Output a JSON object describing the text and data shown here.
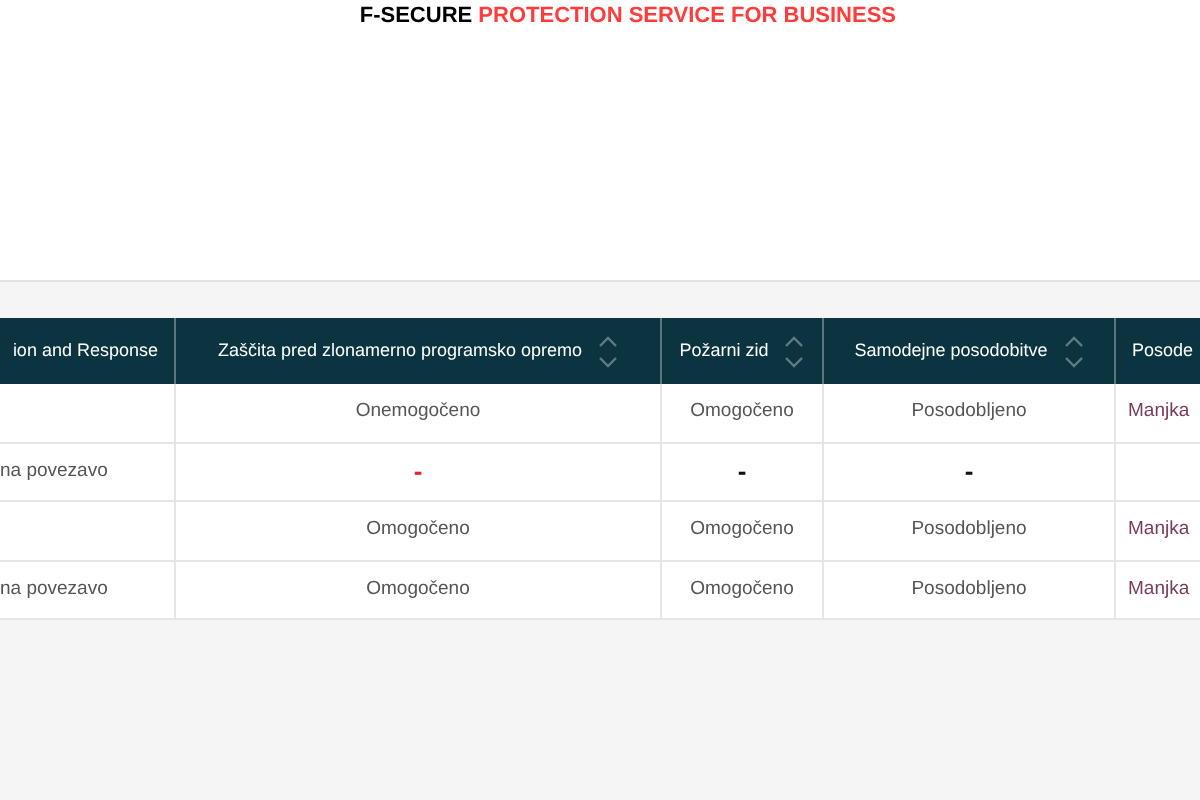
{
  "brand": {
    "name": "F-SECURE",
    "tagline": "PROTECTION SERVICE FOR BUSINESS"
  },
  "table": {
    "columns": [
      {
        "label": "ion and Response"
      },
      {
        "label": "Zaščita pred zlonamerno programsko opremo",
        "sortable": true
      },
      {
        "label": "Požarni zid",
        "sortable": true
      },
      {
        "label": "Samodejne posodobitve",
        "sortable": true
      },
      {
        "label": "Posode"
      }
    ],
    "rows": [
      [
        {
          "kind": "text",
          "text": ""
        },
        {
          "kind": "text",
          "text": "Onemogočeno"
        },
        {
          "kind": "text",
          "text": "Omogočeno"
        },
        {
          "kind": "text",
          "text": "Posodobljeno"
        },
        {
          "kind": "text",
          "text": "Manjka"
        }
      ],
      [
        {
          "kind": "text",
          "text": "na povezavo"
        },
        {
          "kind": "alert",
          "text": "-"
        },
        {
          "kind": "plain",
          "text": "-"
        },
        {
          "kind": "plain",
          "text": "-"
        },
        {
          "kind": "text",
          "text": ""
        }
      ],
      [
        {
          "kind": "text",
          "text": ""
        },
        {
          "kind": "text",
          "text": "Omogočeno"
        },
        {
          "kind": "text",
          "text": "Omogočeno"
        },
        {
          "kind": "text",
          "text": "Posodobljeno"
        },
        {
          "kind": "text",
          "text": "Manjka"
        }
      ],
      [
        {
          "kind": "text",
          "text": "na povezavo"
        },
        {
          "kind": "text",
          "text": "Omogočeno"
        },
        {
          "kind": "text",
          "text": "Omogočeno"
        },
        {
          "kind": "text",
          "text": "Posodobljeno"
        },
        {
          "kind": "text",
          "text": "Manjka"
        }
      ]
    ]
  }
}
